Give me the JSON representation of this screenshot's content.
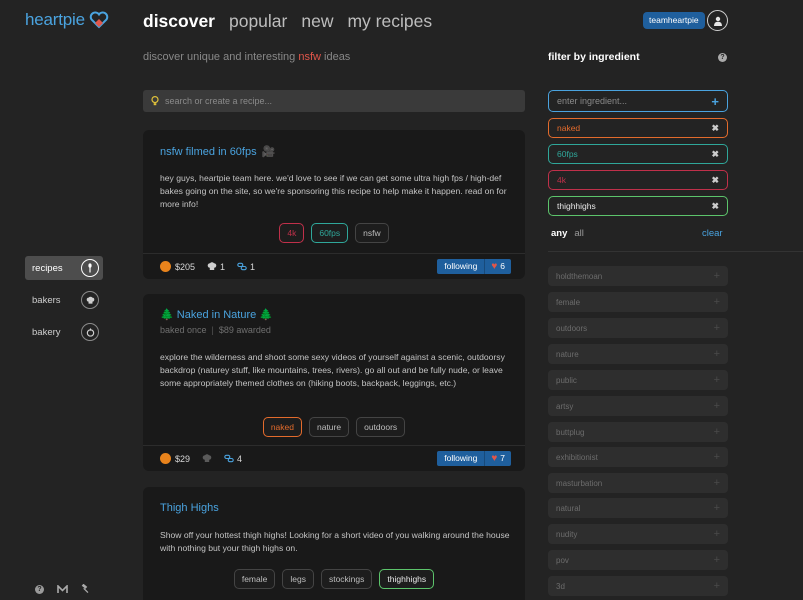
{
  "brand": {
    "name": "heartpie"
  },
  "nav": {
    "tabs": [
      {
        "label": "discover"
      },
      {
        "label": "popular"
      },
      {
        "label": "new"
      },
      {
        "label": "my recipes"
      }
    ]
  },
  "user": {
    "name": "teamheartpie"
  },
  "tagline": {
    "before": "discover unique and interesting ",
    "highlight": "nsfw",
    "after": " ideas"
  },
  "search": {
    "placeholder": "search or create a recipe..."
  },
  "recipes": [
    {
      "title": "nsfw filmed in 60fps",
      "body": "hey guys, heartpie team here. we'd love to see if we can get some ultra high fps / high-def bakes going on the site, so we're sponsoring this recipe to help make it happen. read on for more info!",
      "tags": [
        "4k",
        "60fps",
        "nsfw"
      ],
      "price": "$205",
      "bakers": "1",
      "links": "1",
      "follow_label": "following",
      "likes": "6"
    },
    {
      "title": "Naked in Nature",
      "baked": "baked once",
      "awarded": "$89 awarded",
      "body": "explore the wilderness and shoot some sexy videos of yourself against a scenic, outdoorsy backdrop (naturey stuff, like mountains, trees, rivers). go all out and be fully nude, or leave some appropriately themed clothes on (hiking boots, backpack, leggings, etc.)",
      "tags": [
        "naked",
        "nature",
        "outdoors"
      ],
      "price": "$29",
      "links": "4",
      "follow_label": "following",
      "likes": "7"
    },
    {
      "title": "Thigh Highs",
      "body": "Show off your hottest thigh highs! Looking for a short video of you walking around the house with nothing but your thigh highs on.",
      "tags": [
        "female",
        "legs",
        "stockings",
        "thighhighs"
      ]
    }
  ],
  "sidebar": {
    "items": [
      {
        "label": "recipes"
      },
      {
        "label": "bakers"
      },
      {
        "label": "bakery"
      }
    ]
  },
  "filter": {
    "title": "filter by ingredient",
    "placeholder": "enter ingredient...",
    "selected": [
      {
        "label": "naked",
        "color": "#e36b2c"
      },
      {
        "label": "60fps",
        "color": "#2fa79a"
      },
      {
        "label": "4k",
        "color": "#c0304a"
      },
      {
        "label": "thighhighs",
        "color": "#5cc46b"
      }
    ],
    "any": "any",
    "all": "all",
    "clear": "clear",
    "suggestions": [
      "holdthemoan",
      "female",
      "outdoors",
      "nature",
      "public",
      "artsy",
      "buttplug",
      "exhibitionist",
      "masturbation",
      "natural",
      "nudity",
      "pov",
      "3d"
    ]
  },
  "colors": {
    "accent": "#4aa3df",
    "button": "#1f5f9d",
    "highlight": "#e0564a",
    "coin": "#e8831c",
    "heart": "#e0564a"
  }
}
